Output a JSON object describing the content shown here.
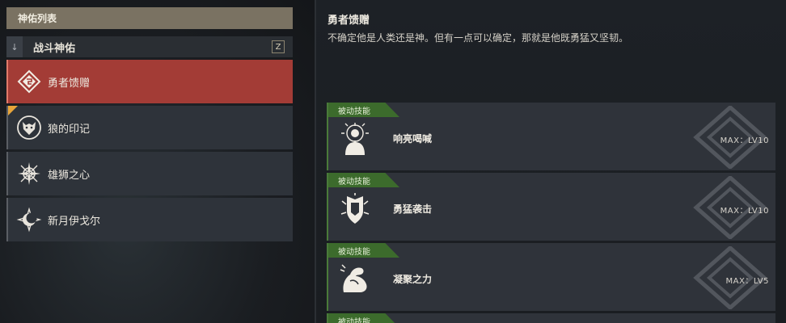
{
  "list": {
    "header": "神佑列表",
    "category": {
      "arrow": "↓",
      "label": "战斗神佑",
      "key": "Z"
    },
    "items": [
      {
        "label": "勇者馈赠",
        "icon": "shield-diamond-icon",
        "active": true
      },
      {
        "label": "狼的印记",
        "icon": "wolf-head-icon",
        "active": false,
        "new": true
      },
      {
        "label": "雄狮之心",
        "icon": "compass-star-icon",
        "active": false
      },
      {
        "label": "新月伊戈尔",
        "icon": "crescent-moon-icon",
        "active": false
      }
    ]
  },
  "detail": {
    "title": "勇者馈赠",
    "description": "不确定他是人类还是神。但有一点可以确定，那就是他既勇猛又坚韧。"
  },
  "skills": [
    {
      "tag": "被动技能",
      "name": "响亮喝喊",
      "level": "MAX：LV10",
      "icon": "shouting-figure-icon"
    },
    {
      "tag": "被动技能",
      "name": "勇猛袭击",
      "level": "MAX：LV10",
      "icon": "shield-strike-icon"
    },
    {
      "tag": "被动技能",
      "name": "凝聚之力",
      "level": "MAX：LV5",
      "icon": "flexed-arm-icon"
    },
    {
      "tag": "被动技能"
    }
  ],
  "colors": {
    "accent_red": "#a33c36",
    "tag_green": "#3c6b2c",
    "header_tan": "#7a7262"
  }
}
